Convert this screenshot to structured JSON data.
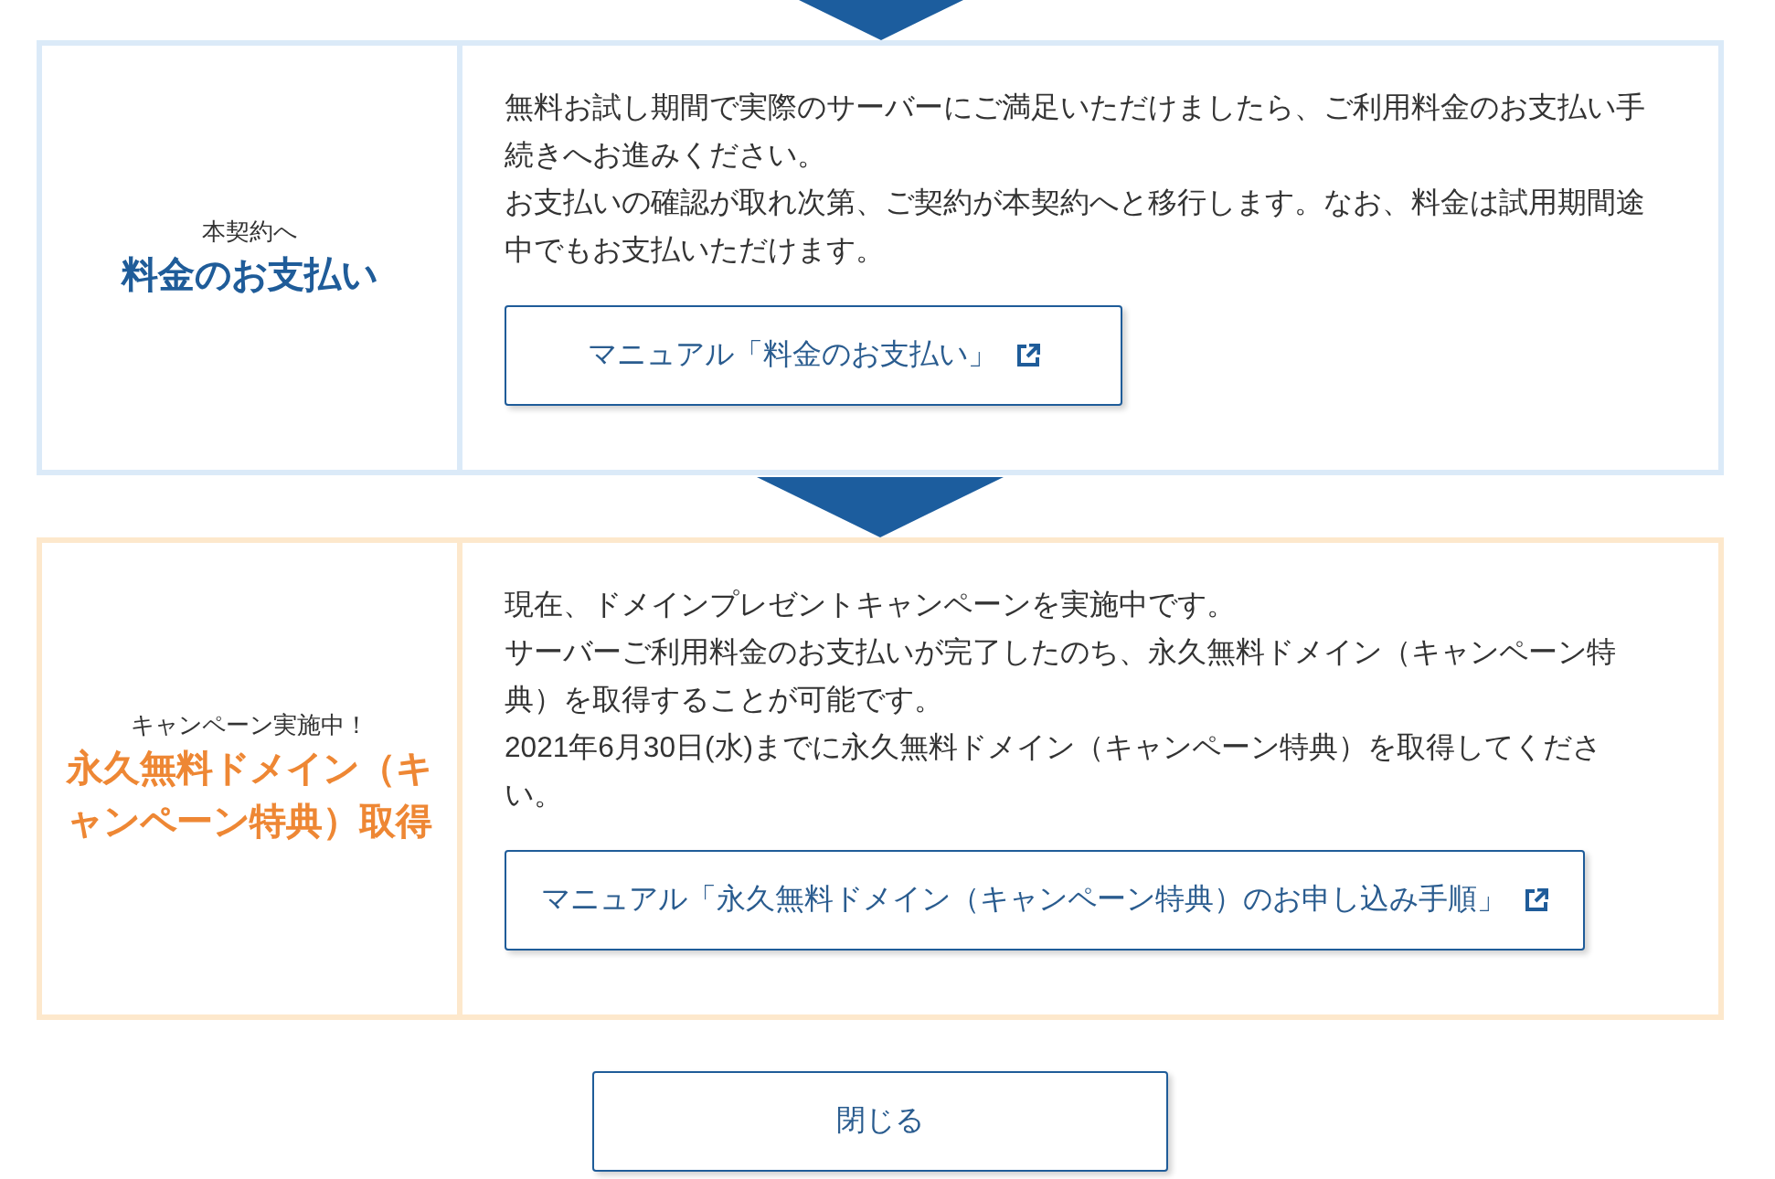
{
  "steps": [
    {
      "kind": "main",
      "lead": "本契約へ",
      "title": "料金のお支払い",
      "paragraphs": [
        "無料お試し期間で実際のサーバーにご満足いただけましたら、ご利用料金のお支払い手続きへお進みください。",
        "お支払いの確認が取れ次第、ご契約が本契約へと移行します。なお、料金は試用期間途中でもお支払いただけます。"
      ],
      "manual_button": "マニュアル「料金のお支払い」"
    },
    {
      "kind": "campaign",
      "lead": "キャンペーン実施中！",
      "title": "永久無料ドメイン（キャンペーン特典）取得",
      "paragraphs": [
        "現在、ドメインプレゼントキャンペーンを実施中です。",
        "サーバーご利用料金のお支払いが完了したのち、永久無料ドメイン（キャンペーン特典）を取得することが可能です。",
        "2021年6月30日(水)までに永久無料ドメイン（キャンペーン特典）を取得してください。"
      ],
      "manual_button": "マニュアル「永久無料ドメイン（キャンペーン特典）のお申し込み手順」"
    }
  ],
  "close_button": "閉じる"
}
